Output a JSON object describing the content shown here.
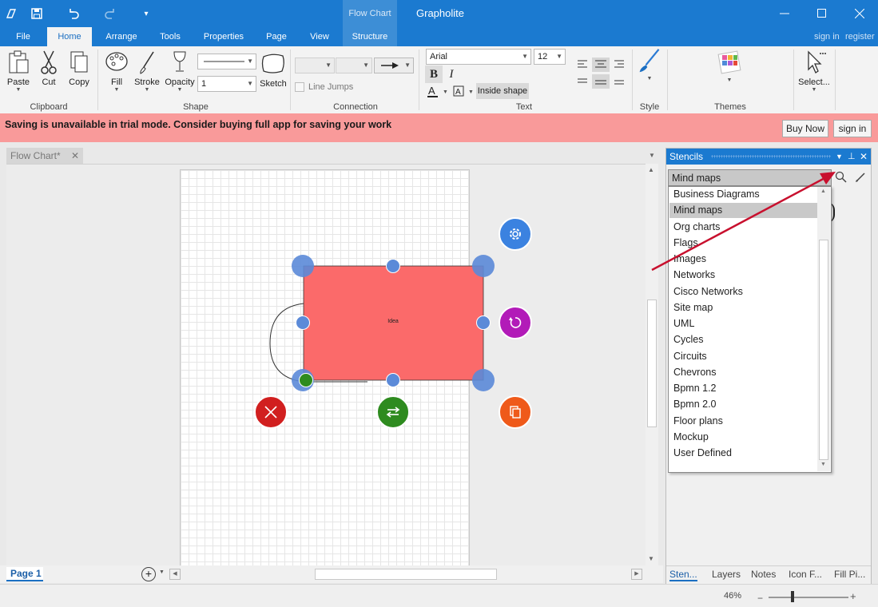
{
  "titlebar": {
    "app_title": "Grapholite",
    "context_tab_title": "Flow Chart",
    "icons": [
      "app-logo-icon",
      "save-icon",
      "undo-icon",
      "redo-icon",
      "customize-icon"
    ],
    "window_buttons": [
      "minimize-icon",
      "maximize-icon",
      "close-icon"
    ]
  },
  "ribbon_tabs": [
    "File",
    "Home",
    "Arrange",
    "Tools",
    "Properties",
    "Page",
    "View",
    "Structure"
  ],
  "active_tab": "Home",
  "account": {
    "sign_in": "sign in",
    "register": "register"
  },
  "ribbon": {
    "clipboard": {
      "label": "Clipboard",
      "paste": "Paste",
      "cut": "Cut",
      "copy": "Copy"
    },
    "shape": {
      "label": "Shape",
      "fill": "Fill",
      "stroke": "Stroke",
      "opacity": "Opacity",
      "sketch": "Sketch",
      "line_width_value": "1"
    },
    "connection": {
      "label": "Connection",
      "line_jumps": "Line Jumps"
    },
    "text": {
      "label": "Text",
      "font": "Arial",
      "size": "12",
      "bold": "B",
      "italic": "I",
      "inside_shape": "Inside shape"
    },
    "style": {
      "label": "Style"
    },
    "themes": {
      "label": "Themes"
    },
    "select": {
      "label": "Select..."
    }
  },
  "banner": {
    "message": "Saving is unavailable in trial mode. Consider buying full app for saving your work",
    "buy_now": "Buy Now",
    "sign_in": "sign in"
  },
  "document": {
    "tab_title": "Flow Chart*",
    "shape_text": "Idea",
    "page_tab": "Page 1",
    "colors": {
      "shape_fill": "#fb6a6a",
      "handle": "#5b8ad8",
      "delete": "#d11f1f",
      "swap": "#2e8b1f",
      "rotate": "#b21bb8",
      "copy": "#ef5a1a",
      "settings": "#3b82e0"
    }
  },
  "stencils": {
    "title": "Stencils",
    "selected": "Mind maps",
    "items": [
      "Business Diagrams",
      "Mind maps",
      "Org charts",
      "Flags",
      "Images",
      "Networks",
      "Cisco Networks",
      "Site map",
      "UML",
      "Cycles",
      "Circuits",
      "Chevrons",
      "Bpmn 1.2",
      "Bpmn 2.0",
      "Floor plans",
      "Mockup",
      "User Defined"
    ],
    "accent_color": "#c8102e"
  },
  "panel_tabs": [
    "Sten...",
    "Layers",
    "Notes",
    "Icon F...",
    "Fill Pi..."
  ],
  "status": {
    "zoom": "46%"
  }
}
